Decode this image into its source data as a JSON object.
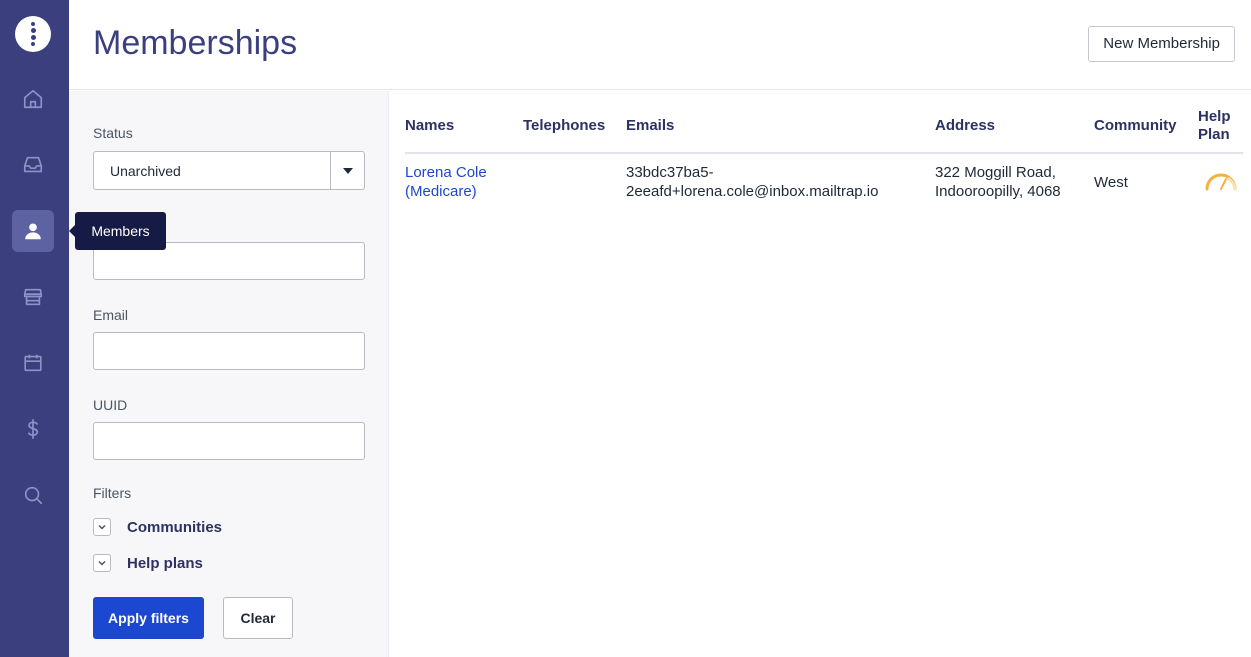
{
  "sidebar": {
    "items": [
      {
        "name": "home",
        "icon": "home-icon"
      },
      {
        "name": "inbox",
        "icon": "inbox-icon"
      },
      {
        "name": "members",
        "icon": "user-icon",
        "active": true
      },
      {
        "name": "store",
        "icon": "store-icon"
      },
      {
        "name": "calendar",
        "icon": "calendar-icon"
      },
      {
        "name": "billing",
        "icon": "dollar-icon"
      },
      {
        "name": "search",
        "icon": "search-icon"
      }
    ],
    "tooltip": "Members"
  },
  "header": {
    "title": "Memberships",
    "new_button": "New Membership"
  },
  "filters": {
    "status_label": "Status",
    "status_value": "Unarchived",
    "email_label": "Email",
    "uuid_label": "UUID",
    "filters_label": "Filters",
    "groups": [
      "Communities",
      "Help plans"
    ],
    "apply_label": "Apply filters",
    "clear_label": "Clear"
  },
  "table": {
    "columns": [
      "Names",
      "Telephones",
      "Emails",
      "Address",
      "Community",
      "Help",
      "Plan"
    ],
    "rows": [
      {
        "name_line1": "Lorena Cole",
        "name_line2": "(Medicare)",
        "telephone": "",
        "email_line1": "33bdc37ba5-",
        "email_line2": "2eeafd+lorena.cole@inbox.mailtrap.io",
        "address_line1": "322 Moggill Road,",
        "address_line2": "Indooroopilly, 4068",
        "community": "West",
        "help_plan_icon": "gauge-icon"
      }
    ]
  },
  "colors": {
    "sidebar": "#3b3f7e",
    "accent": "#1c47d1",
    "gauge": "#f5b041"
  }
}
